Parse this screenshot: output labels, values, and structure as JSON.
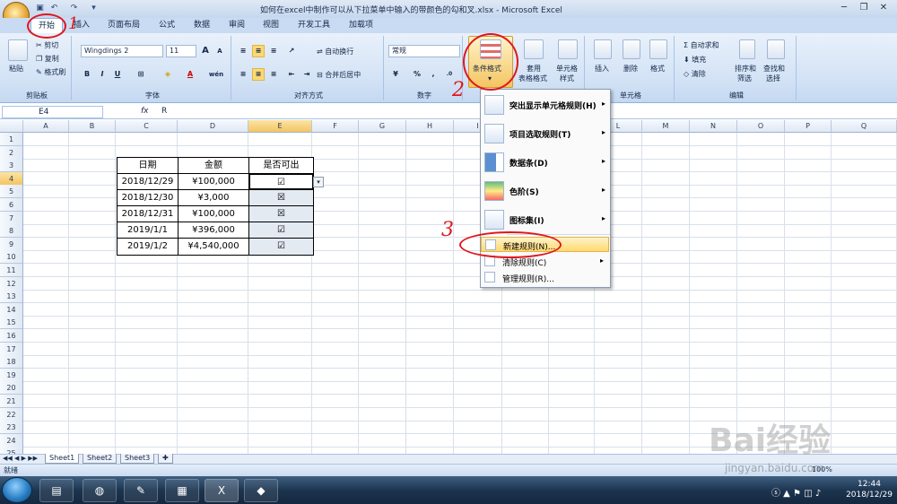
{
  "window": {
    "title": "如何在excel中制作可以从下拉菜单中输入的带颜色的勾和叉.xlsx - Microsoft Excel",
    "qat_icons": [
      "save-icon",
      "undo-icon",
      "redo-icon",
      "quick-access-icon"
    ],
    "controls": {
      "minimize": "─",
      "restore": "❐",
      "close": "✕"
    }
  },
  "tabs": [
    "开始",
    "插入",
    "页面布局",
    "公式",
    "数据",
    "审阅",
    "视图",
    "开发工具",
    "加载项"
  ],
  "ribbon": {
    "clipboard": {
      "label": "剪贴板",
      "paste": "粘贴",
      "cut": "剪切",
      "copy": "复制",
      "format_painter": "格式刷"
    },
    "font": {
      "label": "字体",
      "name": "Wingdings 2",
      "size": "11",
      "grow": "A",
      "shrink": "A",
      "bold": "B",
      "italic": "I",
      "underline": "U",
      "font_color": "A",
      "phonetic": "wén"
    },
    "alignment": {
      "label": "对齐方式",
      "wrap": "自动换行",
      "merge": "合并后居中"
    },
    "number": {
      "label": "数字",
      "format": "常规",
      "percent": "%",
      "comma": ","
    },
    "styles": {
      "label": "样式",
      "cond_format": "条件格式",
      "table_format_1": "套用",
      "table_format_2": "表格格式",
      "cell_style_1": "单元格",
      "cell_style_2": "样式"
    },
    "cells": {
      "label": "单元格",
      "insert": "插入",
      "delete": "删除",
      "format": "格式"
    },
    "editing": {
      "label": "编辑",
      "autosum": "自动求和",
      "fill": "填充",
      "clear": "清除",
      "sort_1": "排序和",
      "sort_2": "筛选",
      "find_1": "查找和",
      "find_2": "选择"
    }
  },
  "formula_bar": {
    "name_box": "E4",
    "fx": "fx",
    "content": "R"
  },
  "columns": [
    "A",
    "B",
    "C",
    "D",
    "E",
    "F",
    "G",
    "H",
    "I",
    "J",
    "K",
    "L",
    "M",
    "N",
    "O",
    "P",
    "Q"
  ],
  "rows": [
    "1",
    "2",
    "3",
    "4",
    "5",
    "6",
    "7",
    "8",
    "9",
    "10",
    "11",
    "12",
    "13",
    "14",
    "15",
    "16",
    "17",
    "18",
    "19",
    "20",
    "21",
    "22",
    "23",
    "24",
    "25"
  ],
  "table": {
    "headers": [
      "日期",
      "金额",
      "是否可出"
    ],
    "rows": [
      [
        "2018/12/29",
        "¥100,000",
        "☑"
      ],
      [
        "2018/12/30",
        "¥3,000",
        "☒"
      ],
      [
        "2018/12/31",
        "¥100,000",
        "☒"
      ],
      [
        "2019/1/1",
        "¥396,000",
        "☑"
      ],
      [
        "2019/1/2",
        "¥4,540,000",
        "☑"
      ]
    ]
  },
  "cond_format_menu": {
    "items": [
      {
        "label": "突出显示单元格规则(H)",
        "has_sub": true
      },
      {
        "label": "项目选取规则(T)",
        "has_sub": true
      },
      {
        "label": "数据条(D)",
        "has_sub": true
      },
      {
        "label": "色阶(S)",
        "has_sub": true
      },
      {
        "label": "图标集(I)",
        "has_sub": true
      }
    ],
    "small_items": [
      {
        "label": "新建规则(N)...",
        "has_sub": false
      },
      {
        "label": "清除规则(C)",
        "has_sub": true
      },
      {
        "label": "管理规则(R)...",
        "has_sub": false
      }
    ]
  },
  "sheets": [
    "Sheet1",
    "Sheet2",
    "Sheet3"
  ],
  "status": {
    "ready": "就绪",
    "zoom": "100%"
  },
  "annotations": {
    "one": "1",
    "two": "2",
    "three": "3"
  },
  "watermark": {
    "logo": "Bai经验",
    "url": "jingyan.baidu.com"
  },
  "taskbar": {
    "time": "12:44",
    "date": "2018/12/29"
  },
  "colors": {
    "accent": "#f4c562",
    "annotation": "#e0161c",
    "ribbon": "#d2e2f5"
  }
}
